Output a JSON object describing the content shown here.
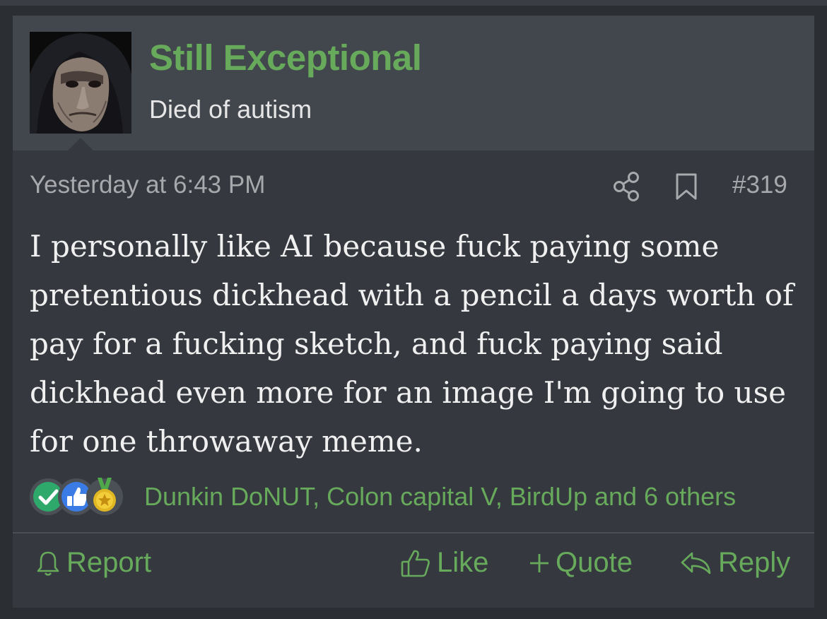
{
  "user": {
    "name": "Still Exceptional",
    "title": "Died of autism",
    "avatar_icon": "hooded-figure-avatar"
  },
  "post": {
    "timestamp": "Yesterday at 6:43 PM",
    "number": "#319",
    "body": "I personally like AI because fuck paying some pretentious dickhead with a pencil a days worth of pay for a fucking sketch, and fuck paying said dickhead even more for an image I'm going to use for one throwaway meme."
  },
  "reactions": {
    "icons": [
      "checkmark-icon",
      "thumbs-up-icon",
      "medal-icon"
    ],
    "summary": "Dunkin DoNUT, Colon capital V, BirdUp and 6 others"
  },
  "actions": {
    "report": "Report",
    "like": "Like",
    "quote": "Quote",
    "reply": "Reply"
  },
  "colors": {
    "accent": "#67aa5b",
    "post_bg": "#35393f",
    "header_bg": "#42464d",
    "page_bg": "#2b2e33"
  }
}
